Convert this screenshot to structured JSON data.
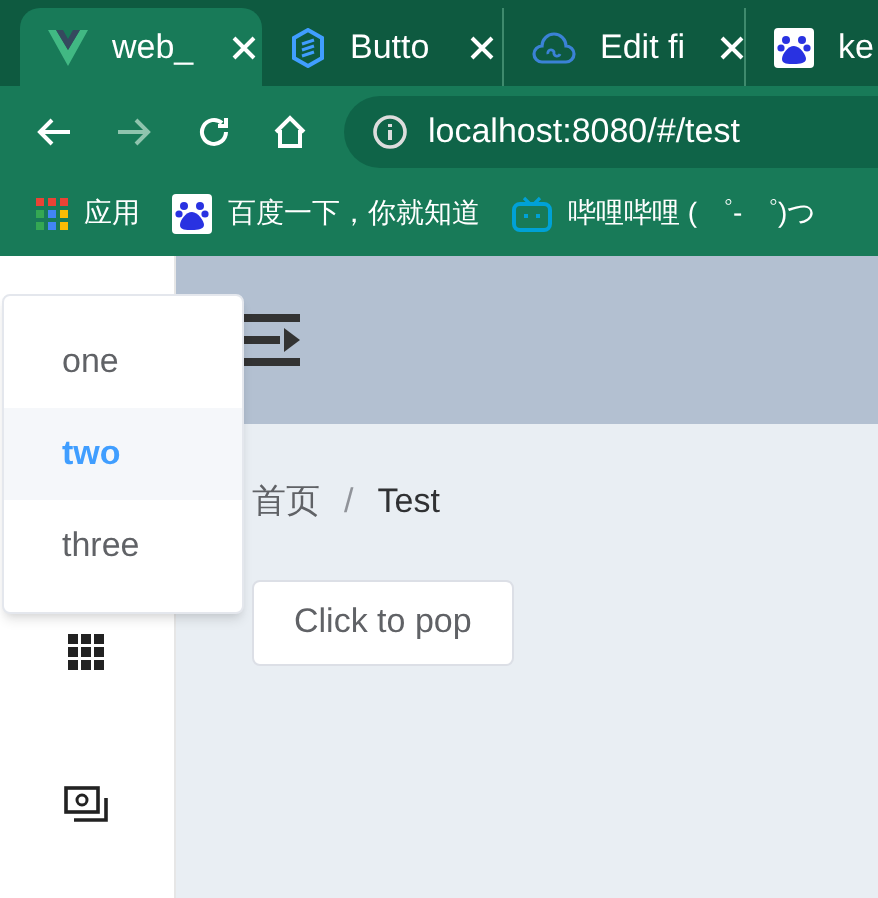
{
  "browser": {
    "tabs": [
      {
        "title": "web_",
        "selected": true
      },
      {
        "title": "Butto",
        "selected": false
      },
      {
        "title": "Edit fi",
        "selected": false
      },
      {
        "title": "ke",
        "selected": false
      }
    ],
    "url": "localhost:8080/#/test",
    "bookmarks": [
      {
        "label": "应用"
      },
      {
        "label": "百度一下，你就知道"
      },
      {
        "label": "哔哩哔哩 ( ゜- ゜)つ"
      }
    ]
  },
  "dropdown": {
    "items": [
      {
        "label": "one",
        "selected": false
      },
      {
        "label": "two",
        "selected": true
      },
      {
        "label": "three",
        "selected": false
      }
    ]
  },
  "breadcrumb": {
    "items": [
      "首页",
      "Test"
    ],
    "separator": "/"
  },
  "button": "Click to pop"
}
